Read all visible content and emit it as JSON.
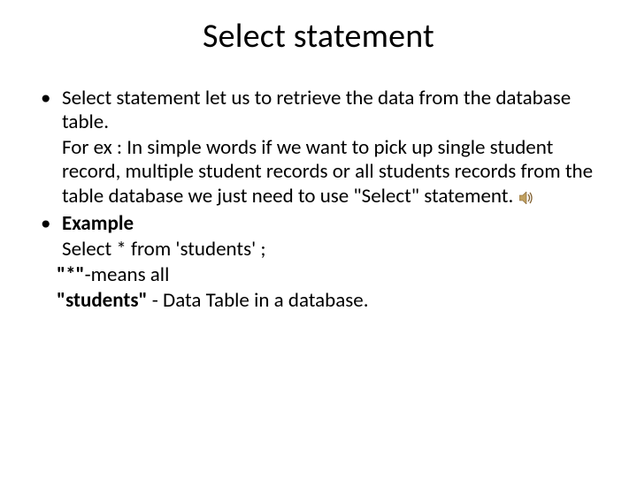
{
  "title": "Select statement",
  "bullet1": {
    "line1": "Select statement let us to retrieve the data from the database table.",
    "line2_prefix": " For ex :  In simple words if we want to pick up single student record, multiple student records or all students records from the table database we just need to use \"Select\" statement."
  },
  "bullet2": {
    "heading": "Example",
    "code": " Select * from 'students' ;",
    "explain1_prefix": "\"*\"",
    "explain1_rest": "-means all",
    "explain2_prefix": "\"students\"",
    "explain2_rest": " - Data Table in a database."
  },
  "icon_name": "sound-icon"
}
